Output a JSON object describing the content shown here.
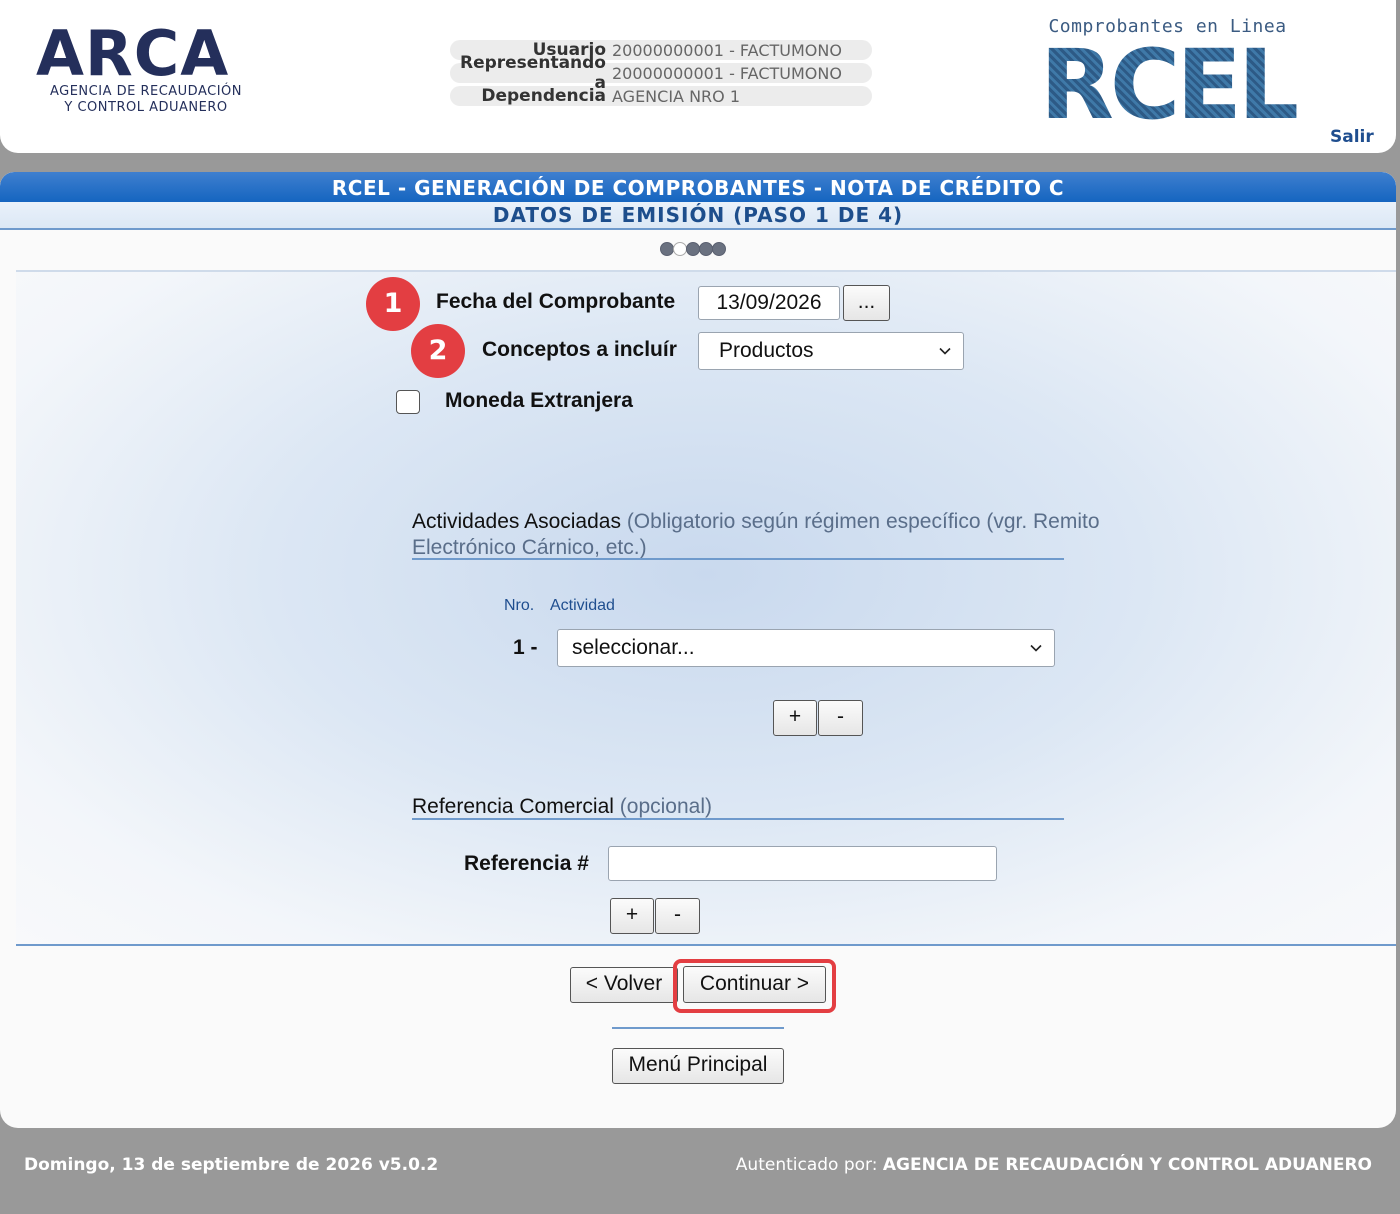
{
  "header": {
    "logo_main": "ARCA",
    "logo_sub_line1": "AGENCIA DE RECAUDACIÓN",
    "logo_sub_line2": "Y CONTROL ADUANERO",
    "user": {
      "usuario_label": "Usuario",
      "usuario_value": "20000000001 - FACTUMONO",
      "representando_label": "Representando a",
      "representando_value": "20000000001 - FACTUMONO",
      "dependencia_label": "Dependencia",
      "dependencia_value": "AGENCIA NRO 1"
    },
    "rcel_tagline": "Comprobantes en Linea",
    "rcel_logo": "RCEL",
    "salir": "Salir"
  },
  "main": {
    "title": "RCEL - GENERACIÓN DE COMPROBANTES - NOTA DE CRÉDITO C",
    "subtitle": "DATOS DE EMISIÓN (PASO 1 DE 4)",
    "steps": {
      "total": 5,
      "current": 2
    },
    "form": {
      "badge1": "1",
      "badge2": "2",
      "fecha_label": "Fecha del Comprobante",
      "fecha_value": "13/09/2026",
      "fecha_picker": "...",
      "conceptos_label": "Conceptos a incluír",
      "conceptos_value": "Productos",
      "moneda_label": "Moneda Extranjera",
      "moneda_checked": false,
      "actividades_title": "Actividades Asociadas",
      "actividades_note": "(Obligatorio según régimen específico (vgr. Remito",
      "actividades_note2": "Electrónico Cárnico, etc.)",
      "col_nro": "Nro.",
      "col_actividad": "Actividad",
      "row_number": "1 -",
      "actividad_value": "seleccionar...",
      "add": "+",
      "remove": "-",
      "referencia_title": "Referencia Comercial",
      "referencia_note": "(opcional)",
      "referencia_label": "Referencia #",
      "referencia_value": ""
    },
    "buttons": {
      "volver": "< Volver",
      "continuar": "Continuar >",
      "menu": "Menú Principal"
    }
  },
  "footer": {
    "date_version": "Domingo, 13 de septiembre de 2026 v5.0.2",
    "auth_label": "Autenticado por:",
    "auth_value": "AGENCIA DE RECAUDACIÓN Y CONTROL ADUANERO"
  },
  "colors": {
    "brand_blue": "#1565c0",
    "badge_red": "#e33e42",
    "footer_gray": "#999999"
  }
}
